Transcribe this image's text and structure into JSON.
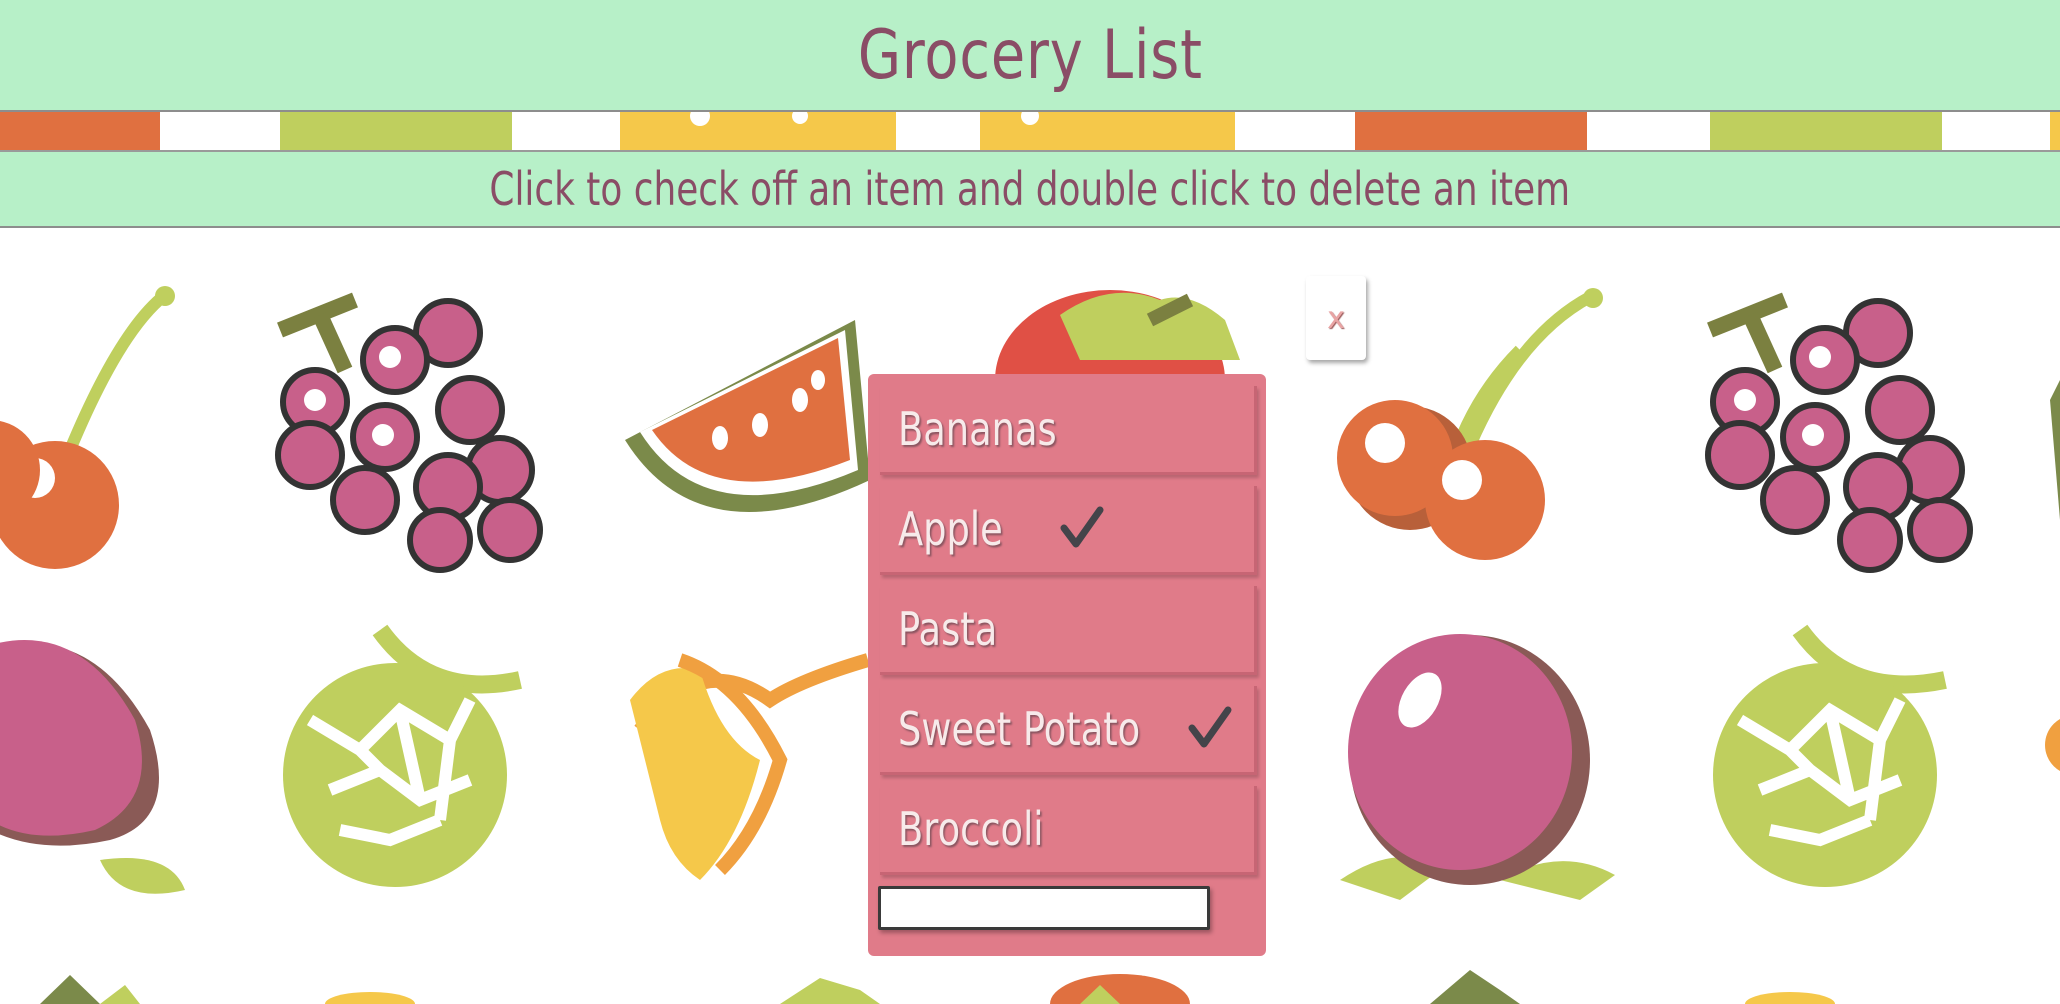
{
  "header": {
    "title": "Grocery List"
  },
  "instructions": {
    "text": "Click to check off an item and double click to delete an item"
  },
  "close_button": {
    "label": "x"
  },
  "list": {
    "items": [
      {
        "label": "Bananas",
        "checked": false
      },
      {
        "label": "Apple",
        "checked": true
      },
      {
        "label": "Pasta",
        "checked": false
      },
      {
        "label": "Sweet Potato",
        "checked": true
      },
      {
        "label": "Broccoli",
        "checked": false
      }
    ],
    "new_item_input": {
      "value": "",
      "placeholder": ""
    }
  },
  "colors": {
    "header_bg": "#b7f0c8",
    "title_text": "#8a4d66",
    "panel_bg": "#e07b89",
    "item_text": "#f7eaea",
    "checkmark": "#44444a"
  },
  "background": {
    "pattern_icons": [
      "cherry-icon",
      "grapes-icon",
      "watermelon-icon",
      "strawberry-icon",
      "peach-icon",
      "melon-icon",
      "banana-icon",
      "pineapple-icon",
      "orange-icon",
      "lemon-icon"
    ]
  }
}
